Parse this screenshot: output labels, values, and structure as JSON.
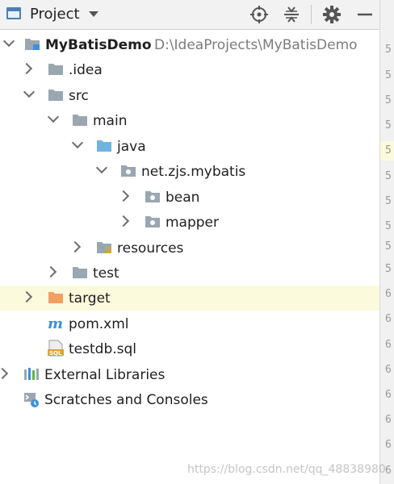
{
  "toolbar": {
    "title": "Project",
    "icons": [
      "project-view-icon",
      "locate-icon",
      "collapse-all-icon",
      "gear-icon",
      "hide-icon"
    ]
  },
  "tree": {
    "root_label": "MyBatisDemo",
    "root_path": "D:\\IdeaProjects\\MyBatisDemo",
    "idea": ".idea",
    "src": "src",
    "main": "main",
    "java": "java",
    "package": "net.zjs.mybatis",
    "bean": "bean",
    "mapper": "mapper",
    "resources": "resources",
    "test": "test",
    "target": "target",
    "pom": "pom.xml",
    "sql": "testdb.sql",
    "ext_libs": "External Libraries",
    "scratches": "Scratches and Consoles"
  },
  "colors": {
    "folder": "#9aa7b0",
    "source_folder": "#6fb4dd",
    "excluded_folder": "#f0a060",
    "maven_blue": "#3e8fd8",
    "selected_row": "#fcfadc"
  },
  "gutter": {
    "lines": [
      "5",
      "5",
      "5",
      "5",
      "5",
      "5",
      "5",
      "5",
      "5",
      "5",
      "6",
      "6",
      "6",
      "6",
      "6",
      "6",
      "6",
      "6",
      "6"
    ]
  },
  "watermark": "https://blog.csdn.net/qq_48838980"
}
